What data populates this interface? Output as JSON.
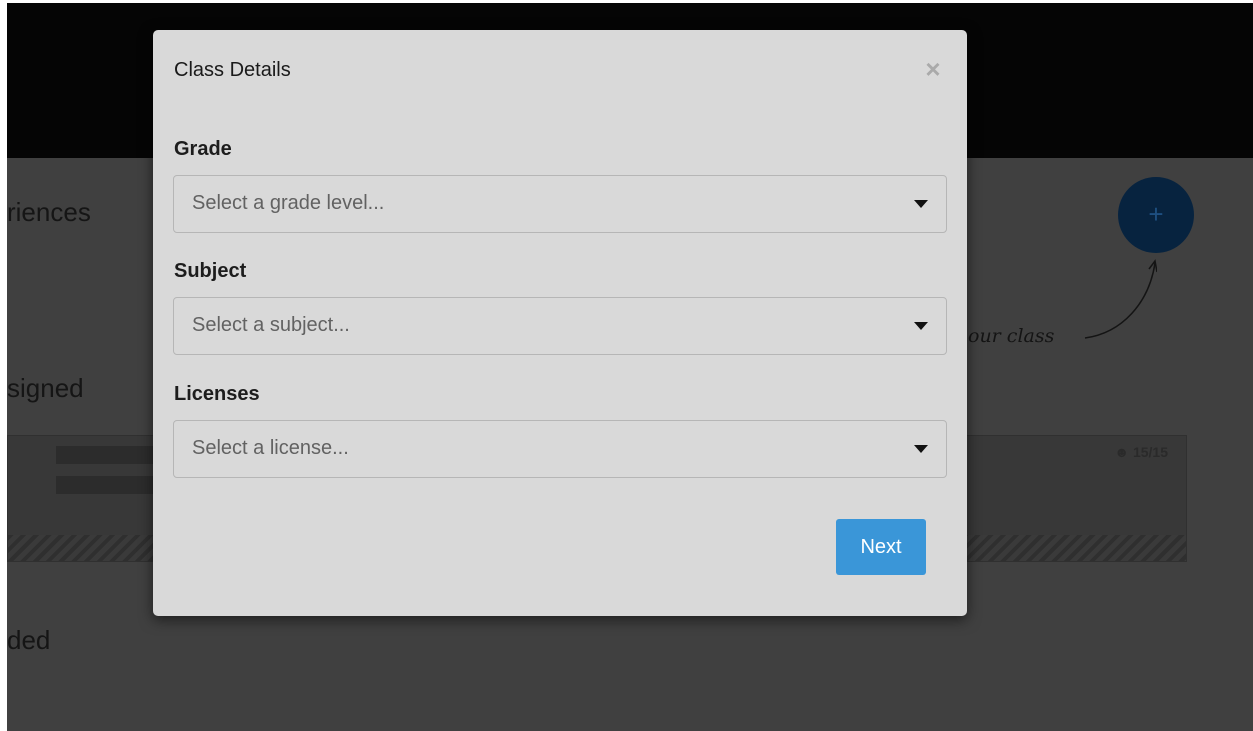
{
  "background": {
    "heading_experiences": "riences",
    "heading_assigned": "signed",
    "heading_ended": "ded",
    "fab_label": "+",
    "hint_text": "our class",
    "card_count": "15/15"
  },
  "modal": {
    "title": "Class Details",
    "close_label": "×",
    "fields": [
      {
        "label": "Grade",
        "placeholder": "Select a grade level..."
      },
      {
        "label": "Subject",
        "placeholder": "Select a subject..."
      },
      {
        "label": "Licenses",
        "placeholder": "Select a license..."
      }
    ],
    "next_label": "Next"
  },
  "colors": {
    "primary_button": "#3a96d8",
    "modal_background": "#d9d9d9",
    "overlay": "#3a3a3a",
    "fab": "#07233f"
  },
  "icons": {
    "close": "close-icon",
    "caret": "chevron-down-icon",
    "add": "plus-icon",
    "user": "user-icon"
  }
}
